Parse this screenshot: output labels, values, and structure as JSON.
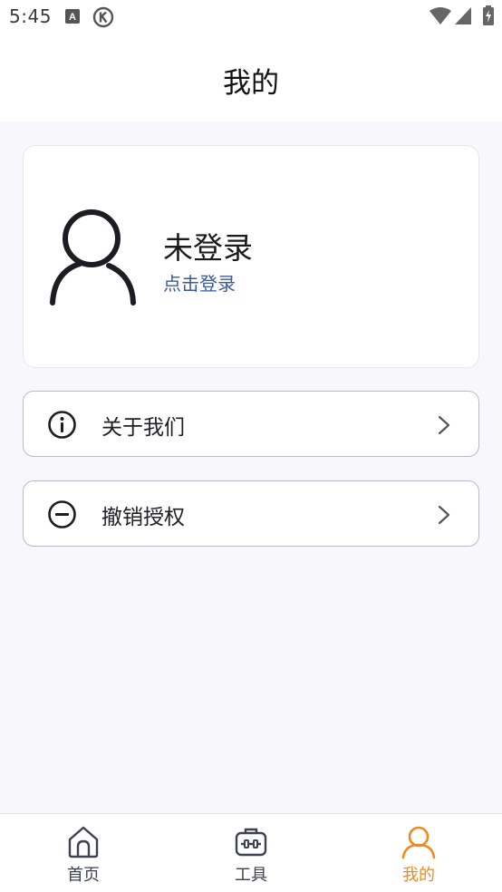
{
  "status_bar": {
    "time": "5:45",
    "icons": [
      "font-a-icon",
      "k-circle-icon",
      "wifi-icon",
      "signal-icon",
      "battery-charging-icon"
    ]
  },
  "header": {
    "title": "我的"
  },
  "profile": {
    "avatar_icon": "user-outline-icon",
    "status_text": "未登录",
    "login_link": "点击登录"
  },
  "menu": [
    {
      "icon": "info-circle-icon",
      "label": "关于我们"
    },
    {
      "icon": "minus-circle-icon",
      "label": "撤销授权"
    }
  ],
  "bottom_nav": {
    "items": [
      {
        "icon": "home-icon",
        "label": "首页",
        "active": false
      },
      {
        "icon": "toolbox-icon",
        "label": "工具",
        "active": false
      },
      {
        "icon": "user-icon",
        "label": "我的",
        "active": true
      }
    ]
  },
  "colors": {
    "accent_active": "#f08a1c",
    "link": "#3a5a9e",
    "background": "#f7f7fc"
  }
}
